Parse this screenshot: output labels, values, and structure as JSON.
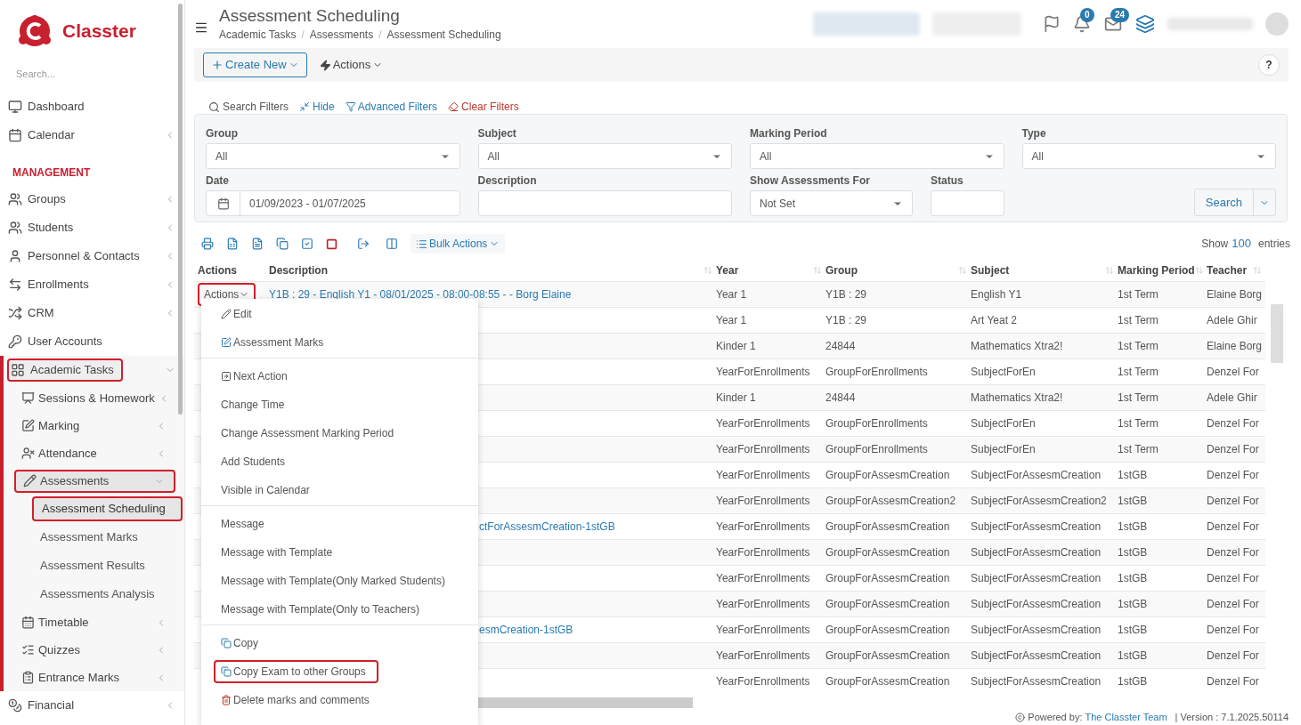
{
  "brand": {
    "name": "Classter"
  },
  "sidebar": {
    "search_placeholder": "Search...",
    "items": [
      {
        "label": "Dashboard",
        "expandable": false,
        "expanded": false,
        "highlighted": false
      },
      {
        "label": "Calendar",
        "expandable": true,
        "expanded": false,
        "highlighted": false
      },
      {
        "kind": "section",
        "label": "MANAGEMENT"
      },
      {
        "label": "Groups",
        "expandable": true,
        "expanded": false,
        "highlighted": false
      },
      {
        "label": "Students",
        "expandable": true,
        "expanded": false,
        "highlighted": false
      },
      {
        "label": "Personnel & Contacts",
        "expandable": true,
        "expanded": false,
        "highlighted": false
      },
      {
        "label": "Enrollments",
        "expandable": true,
        "expanded": false,
        "highlighted": false
      },
      {
        "label": "CRM",
        "expandable": true,
        "expanded": false,
        "highlighted": false
      },
      {
        "label": "User Accounts",
        "expandable": false,
        "expanded": false,
        "highlighted": false
      },
      {
        "label": "Academic Tasks",
        "expandable": true,
        "expanded": true,
        "highlighted": true,
        "children": [
          {
            "label": "Sessions & Homework",
            "expandable": true,
            "expanded": false,
            "highlighted": false
          },
          {
            "label": "Marking",
            "expandable": true,
            "expanded": false,
            "highlighted": false
          },
          {
            "label": "Attendance",
            "expandable": true,
            "expanded": false,
            "highlighted": false
          },
          {
            "label": "Assessments",
            "expandable": true,
            "expanded": true,
            "highlighted": true,
            "children": [
              {
                "label": "Assessment Scheduling",
                "selected": true,
                "highlighted": true
              },
              {
                "label": "Assessment Marks",
                "selected": false,
                "highlighted": false
              },
              {
                "label": "Assessment Results",
                "selected": false,
                "highlighted": false
              },
              {
                "label": "Assessments Analysis",
                "selected": false,
                "highlighted": false
              }
            ]
          },
          {
            "label": "Timetable",
            "expandable": true,
            "expanded": false,
            "highlighted": false
          },
          {
            "label": "Quizzes",
            "expandable": true,
            "expanded": false,
            "highlighted": false
          },
          {
            "label": "Entrance Marks",
            "expandable": true,
            "expanded": false,
            "highlighted": false
          }
        ]
      },
      {
        "label": "Financial",
        "expandable": true,
        "expanded": false,
        "highlighted": false
      }
    ]
  },
  "header": {
    "title": "Assessment Scheduling",
    "breadcrumb": [
      "Academic Tasks",
      "Assessments",
      "Assessment Scheduling"
    ],
    "breadcrumb_separator": "/",
    "notifications_badge": "0",
    "messages_badge": "24"
  },
  "toolbar": {
    "create_new": "Create New",
    "actions": "Actions",
    "help": "?"
  },
  "filters": {
    "legend": "Search Filters",
    "hide": "Hide",
    "advanced": "Advanced Filters",
    "clear": "Clear Filters",
    "fields": [
      {
        "kind": "select",
        "label": "Group",
        "value": "All"
      },
      {
        "kind": "select",
        "label": "Subject",
        "value": "All"
      },
      {
        "kind": "select",
        "label": "Marking Period",
        "value": "All"
      },
      {
        "kind": "select",
        "label": "Type",
        "value": "All"
      },
      {
        "kind": "date",
        "label": "Date",
        "value": "01/09/2023 - 01/07/2025"
      },
      {
        "kind": "text",
        "label": "Description"
      },
      {
        "kind": "select",
        "label": "Show Assessments For",
        "value": "Not Set"
      },
      {
        "kind": "text",
        "label": "Status"
      }
    ],
    "search": "Search"
  },
  "table": {
    "bulk_actions": "Bulk Actions",
    "show": "Show",
    "page_size": "100",
    "entries": "entries",
    "columns": [
      "Actions",
      "Description",
      "Year",
      "Group",
      "Subject",
      "Marking Period",
      "Teacher"
    ],
    "row_action": {
      "label": "Actions",
      "highlighted": true
    },
    "rows": [
      {
        "description": "Y1B : 29 - English Y1 - 08/01/2025 - 08:00-08:55 - - Borg Elaine",
        "year": "Year 1",
        "group": "Y1B : 29",
        "subject": "English Y1",
        "marking_period": "1st Term",
        "teacher": "Elaine Borg"
      },
      {
        "year": "Year 1",
        "group": "Y1B : 29",
        "subject": "Art Yeat 2",
        "marking_period": "1st Term",
        "teacher": "Adele Ghir"
      },
      {
        "year": "Kinder 1",
        "group": "24844",
        "subject": "Mathematics Xtra2!",
        "marking_period": "1st Term",
        "teacher": "Elaine Borg"
      },
      {
        "year": "YearForEnrollments",
        "group": "GroupForEnrollments",
        "subject": "SubjectForEn",
        "marking_period": "1st Term",
        "teacher": "Denzel For"
      },
      {
        "year": "Kinder 1",
        "group": "24844",
        "subject": "Mathematics Xtra2!",
        "marking_period": "1st Term",
        "teacher": "Adele Ghir"
      },
      {
        "year": "YearForEnrollments",
        "group": "GroupForEnrollments",
        "subject": "SubjectForEn",
        "marking_period": "1st Term",
        "teacher": "Denzel For"
      },
      {
        "year": "YearForEnrollments",
        "group": "GroupForEnrollments",
        "subject": "SubjectForEn",
        "marking_period": "1st Term",
        "teacher": "Denzel For"
      },
      {
        "year": "YearForEnrollments",
        "group": "GroupForAssesmCreation",
        "subject": "SubjectForAssesmCreation",
        "marking_period": "1stGB",
        "teacher": "Denzel For"
      },
      {
        "year": "YearForEnrollments",
        "group": "GroupForAssesmCreation2",
        "subject": "SubjectForAssesmCreation2",
        "marking_period": "1stGB",
        "teacher": "Denzel For"
      },
      {
        "description": "ctForAssesmCreation-1stGB",
        "year": "YearForEnrollments",
        "group": "GroupForAssesmCreation",
        "subject": "SubjectForAssesmCreation",
        "marking_period": "1stGB",
        "teacher": "Denzel For"
      },
      {
        "year": "YearForEnrollments",
        "group": "GroupForAssesmCreation",
        "subject": "SubjectForAssesmCreation",
        "marking_period": "1stGB",
        "teacher": "Denzel For"
      },
      {
        "year": "YearForEnrollments",
        "group": "GroupForAssesmCreation",
        "subject": "SubjectForAssesmCreation",
        "marking_period": "1stGB",
        "teacher": "Denzel For"
      },
      {
        "year": "YearForEnrollments",
        "group": "GroupForAssesmCreation",
        "subject": "SubjectForAssesmCreation",
        "marking_period": "1stGB",
        "teacher": "Denzel For"
      },
      {
        "description": "esmCreation-1stGB",
        "year": "YearForEnrollments",
        "group": "GroupForAssesmCreation",
        "subject": "SubjectForAssesmCreation",
        "marking_period": "1stGB",
        "teacher": "Denzel For"
      },
      {
        "year": "YearForEnrollments",
        "group": "GroupForAssesmCreation",
        "subject": "SubjectForAssesmCreation",
        "marking_period": "1stGB",
        "teacher": "Denzel For"
      },
      {
        "year": "YearForEnrollments",
        "group": "GroupForAssesmCreation",
        "subject": "SubjectForAssesmCreation",
        "marking_period": "1stGB",
        "teacher": "Denzel For"
      }
    ]
  },
  "action_menu": {
    "groups": [
      [
        {
          "label": "Edit",
          "highlighted": false
        },
        {
          "label": "Assessment Marks",
          "highlighted": false
        }
      ],
      [
        {
          "label": "Next Action",
          "highlighted": false
        },
        {
          "label": "Change Time",
          "highlighted": false
        },
        {
          "label": "Change Assessment Marking Period",
          "highlighted": false
        },
        {
          "label": "Add Students",
          "highlighted": false
        },
        {
          "label": "Visible in Calendar",
          "highlighted": false
        }
      ],
      [
        {
          "label": "Message",
          "highlighted": false
        },
        {
          "label": "Message with Template",
          "highlighted": false
        },
        {
          "label": "Message with Template(Only Marked Students)",
          "highlighted": false
        },
        {
          "label": "Message with Template(Only to Teachers)",
          "highlighted": false
        }
      ],
      [
        {
          "label": "Copy",
          "highlighted": false
        },
        {
          "label": "Copy Exam to other Groups",
          "highlighted": true
        },
        {
          "label": "Delete marks and comments",
          "highlighted": false
        }
      ]
    ]
  },
  "footer": {
    "powered_by": "Powered by:",
    "team": "The Classter Team",
    "version": "| Version : 7.1.2025.50114"
  }
}
